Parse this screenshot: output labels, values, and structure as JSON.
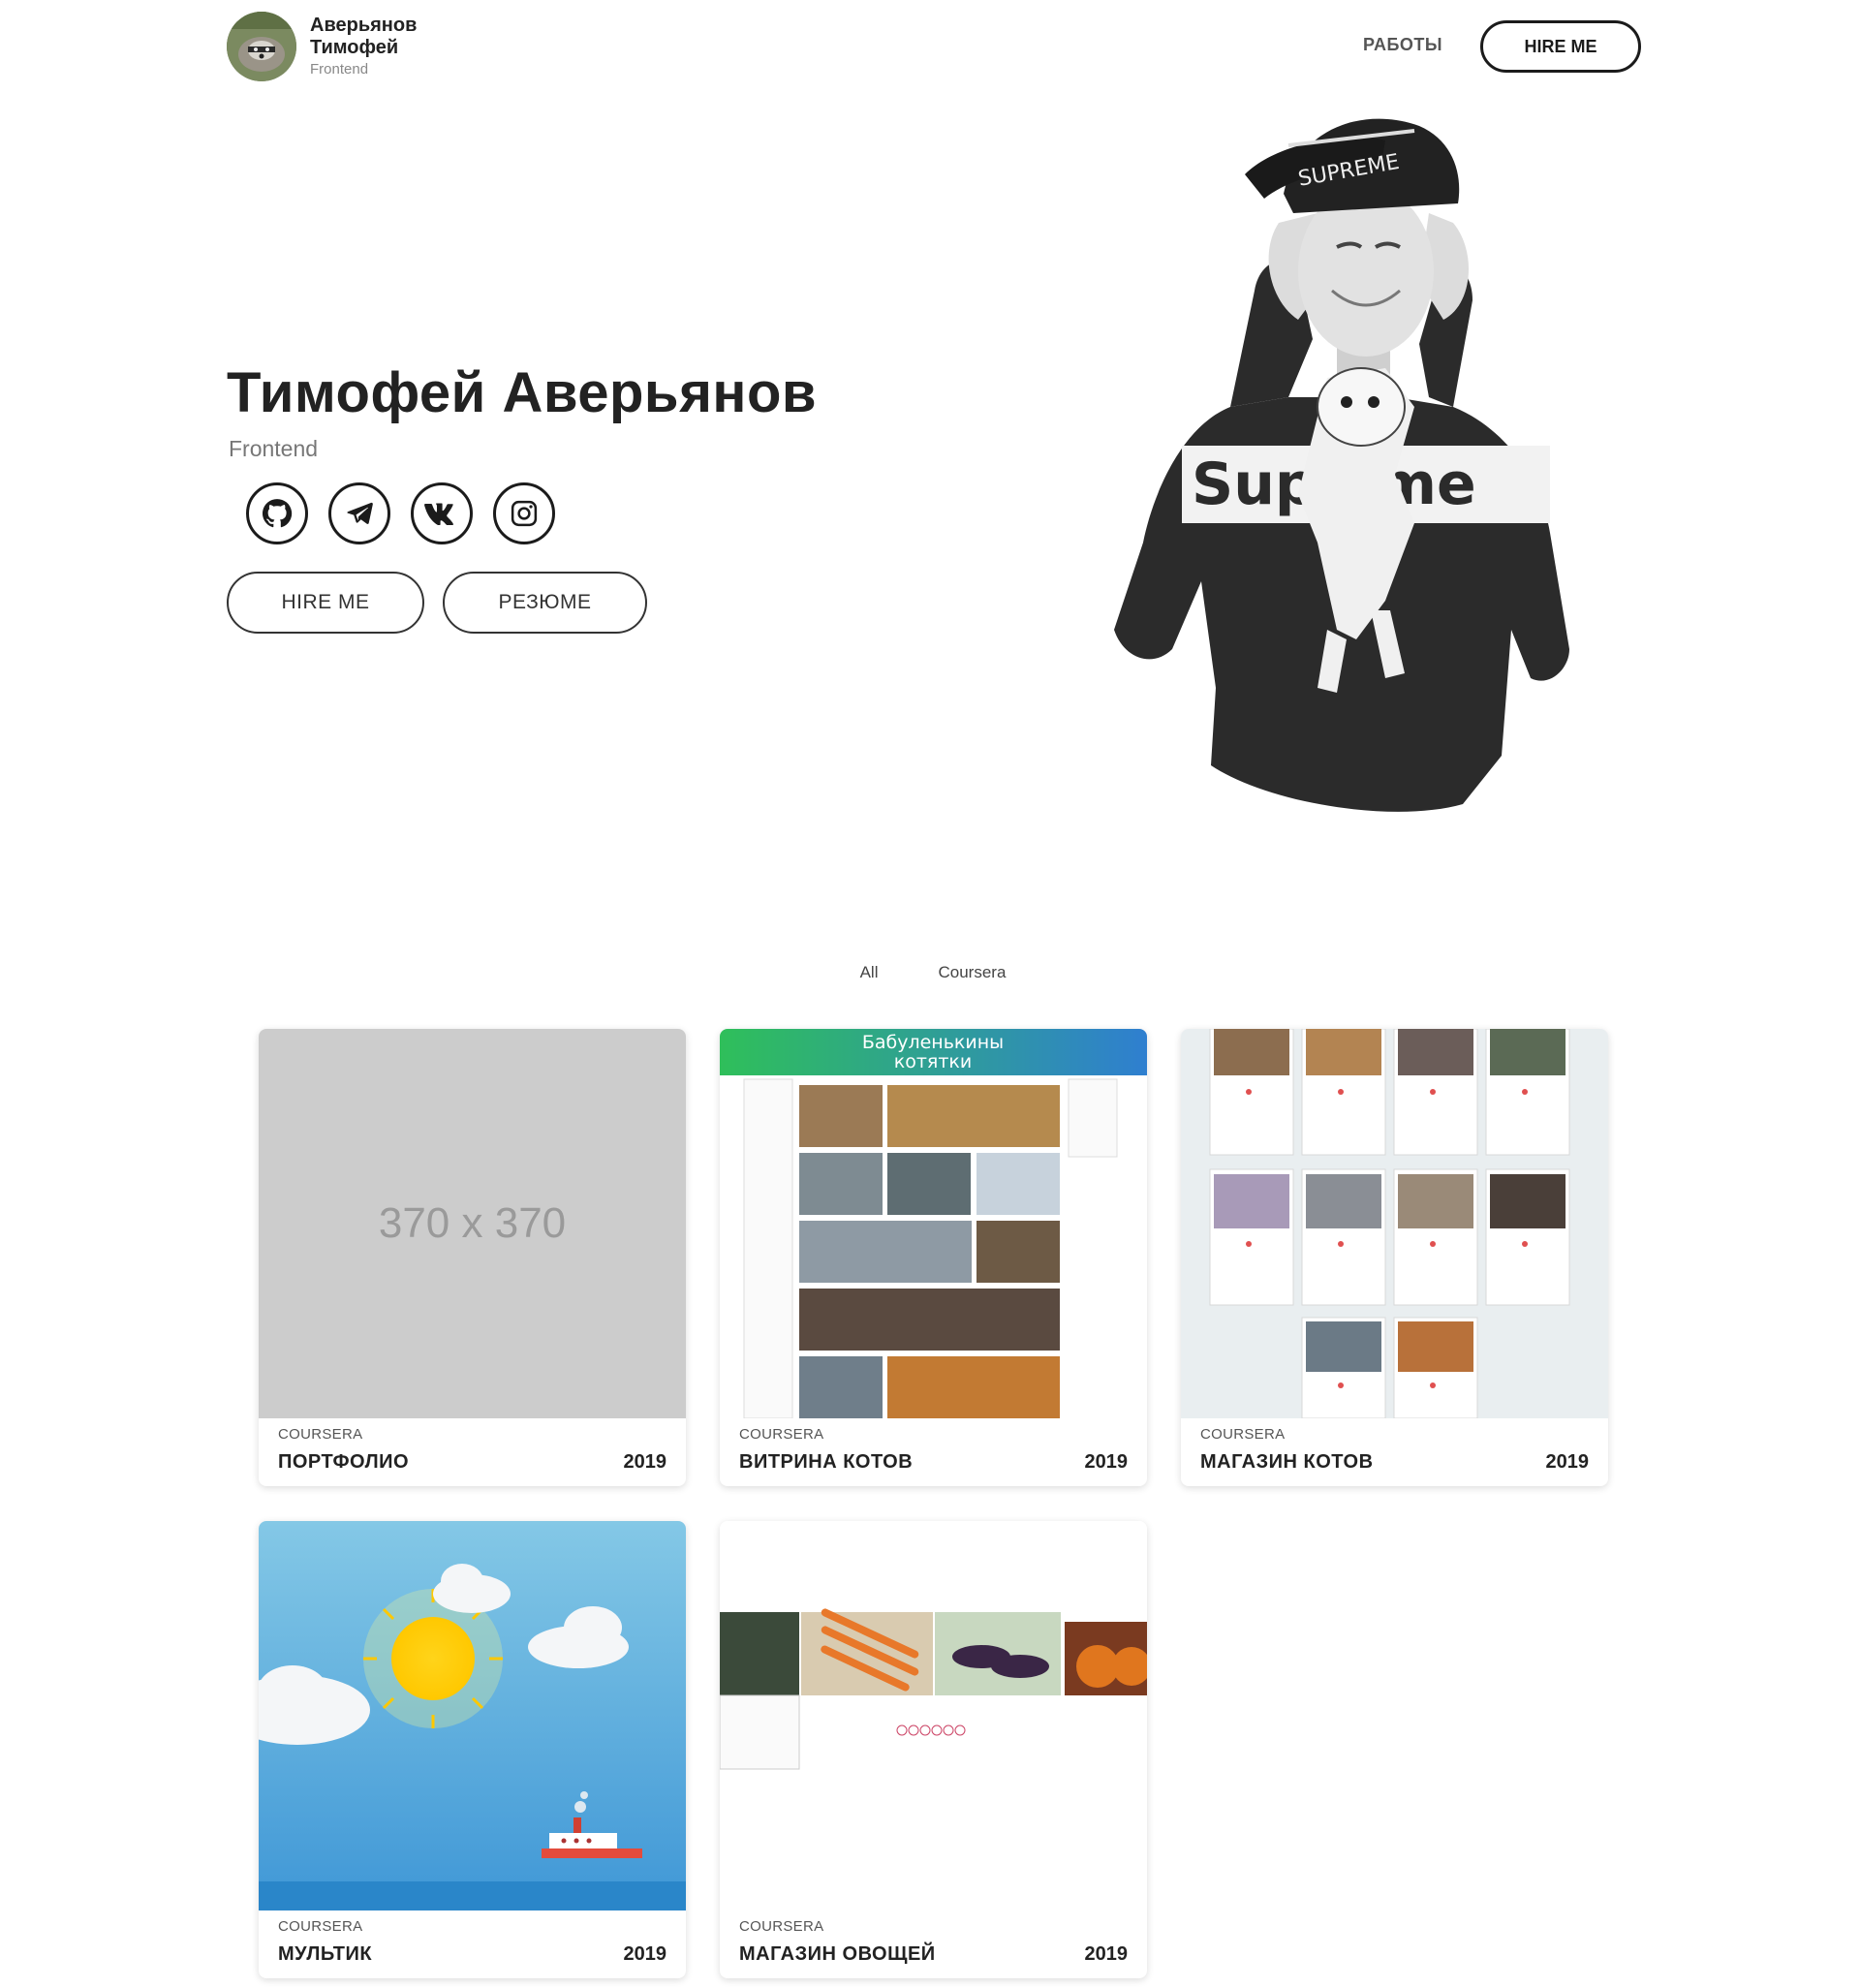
{
  "header": {
    "brand_name_line1": "Аверьянов",
    "brand_name_line2": "Тимофей",
    "brand_role": "Frontend",
    "nav_works": "РАБОТЫ",
    "nav_hire": "HIRE ME"
  },
  "hero": {
    "title": "Тимофей Аверьянов",
    "subtitle": "Frontend",
    "socials": [
      "github-icon",
      "telegram-icon",
      "vk-icon",
      "instagram-icon"
    ],
    "hire_button": "HIRE ME",
    "resume_button": "РЕЗЮМЕ"
  },
  "filters": [
    "All",
    "Coursera"
  ],
  "projects": [
    {
      "category": "COURSERA",
      "name": "ПОРТФОЛИО",
      "year": "2019",
      "thumb_text": "370 x 370"
    },
    {
      "category": "COURSERA",
      "name": "ВИТРИНА КОТОВ",
      "year": "2019",
      "thumb_text": "Бабуленькины котятки"
    },
    {
      "category": "COURSERA",
      "name": "МАГАЗИН КОТОВ",
      "year": "2019"
    },
    {
      "category": "COURSERA",
      "name": "МУЛЬТИК",
      "year": "2019"
    },
    {
      "category": "COURSERA",
      "name": "МАГАЗИН ОВОЩЕЙ",
      "year": "2019"
    }
  ]
}
